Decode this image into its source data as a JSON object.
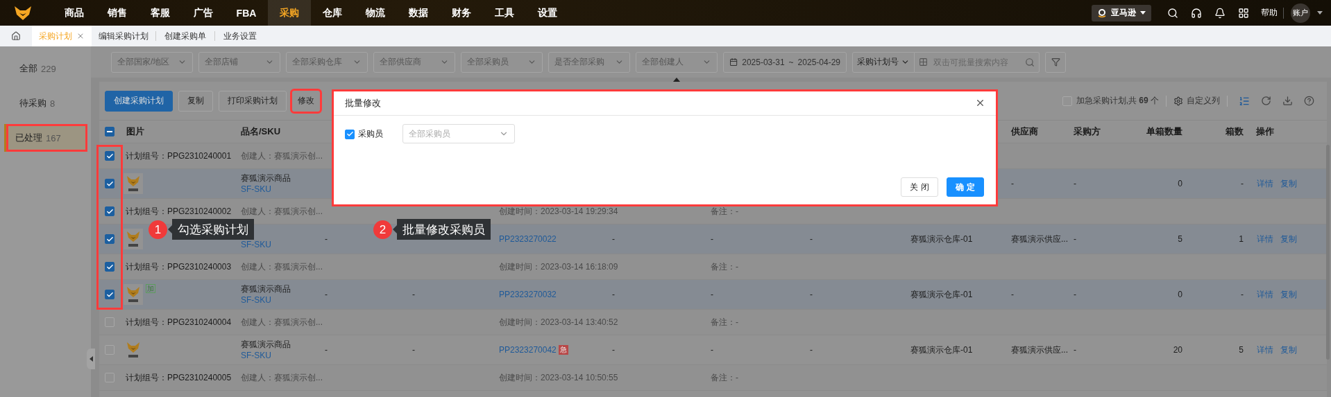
{
  "nav": {
    "menu": [
      {
        "label": "商品",
        "selected": false
      },
      {
        "label": "销售",
        "selected": false
      },
      {
        "label": "客服",
        "selected": false
      },
      {
        "label": "广告",
        "selected": false
      },
      {
        "label": "FBA",
        "selected": false
      },
      {
        "label": "采购",
        "selected": true
      },
      {
        "label": "仓库",
        "selected": false
      },
      {
        "label": "物流",
        "selected": false
      },
      {
        "label": "数据",
        "selected": false
      },
      {
        "label": "财务",
        "selected": false
      },
      {
        "label": "工具",
        "selected": false
      },
      {
        "label": "设置",
        "selected": false
      }
    ],
    "store": "亚马逊",
    "help": "帮助",
    "account": "账户"
  },
  "tabs": [
    {
      "label": "采购计划",
      "selected": true,
      "closable": true
    },
    {
      "label": "编辑采购计划",
      "selected": false,
      "closable": false
    },
    {
      "label": "创建采购单",
      "selected": false,
      "closable": false
    },
    {
      "label": "业务设置",
      "selected": false,
      "closable": false
    }
  ],
  "sidebar": [
    {
      "label": "全部",
      "count": "229",
      "selected": false,
      "highlighted": false
    },
    {
      "label": "待采购",
      "count": "8",
      "selected": false,
      "highlighted": false
    },
    {
      "label": "已处理",
      "count": "167",
      "selected": true,
      "highlighted": true
    }
  ],
  "filters": {
    "selects": [
      "全部国家/地区",
      "全部店铺",
      "全部采购仓库",
      "全部供应商",
      "全部采购员",
      "是否全部采购",
      "全部创建人"
    ],
    "date_start": "2025-03-31",
    "date_sep": "~",
    "date_end": "2025-04-29",
    "search_field": "采购计划号",
    "search_placeholder": "双击可批量搜索内容"
  },
  "toolbar": {
    "buttons": [
      {
        "label": "创建采购计划",
        "kind": "primary",
        "highlighted": false
      },
      {
        "label": "复制",
        "kind": "default",
        "highlighted": false
      },
      {
        "label": "打印采购计划",
        "kind": "default",
        "highlighted": false
      },
      {
        "label": "修改",
        "kind": "text",
        "highlighted": true
      }
    ],
    "urgent": {
      "label": "加急采购计划,共 **69** 个",
      "checked": false
    },
    "columns_label": "自定义列"
  },
  "table": {
    "header_partial": true,
    "checkbox_highlight": true,
    "headers": {
      "picture": "图片",
      "name_sku": "品名/SKU",
      "supplier": "供应商",
      "buyer": "采购方",
      "per_box_qty": "单箱数量",
      "boxes": "箱数",
      "actions": "操作"
    },
    "groups": [
      {
        "checked": true,
        "plan_group": "计划组号：PPG2310240001",
        "creator": "创建人：赛狐演示创...",
        "item": {
          "checked": true,
          "name": "赛狐演示商品",
          "sku": "SF-SKU",
          "supplier": "-",
          "buyer": "-",
          "per_box_qty": "0",
          "boxes": "-",
          "actions": [
            "详情",
            "复制"
          ]
        }
      },
      {
        "checked": true,
        "plan_group": "计划组号：PPG2310240002",
        "creator": "创建人：赛狐演示创...",
        "created_at": "创建时间：2023-03-14 19:29:34",
        "remark": "备注：-",
        "item": {
          "checked": true,
          "sku": "SF-SKU",
          "col_a": "-",
          "plan_no": "PP2323270022",
          "col_d": "-",
          "col_e": "-",
          "col_f": "-",
          "warehouse": "赛狐演示仓库-01",
          "supplier": "赛狐演示供应...",
          "buyer": "-",
          "per_box_qty": "5",
          "boxes": "1",
          "actions": [
            "详情",
            "复制"
          ]
        }
      },
      {
        "checked": true,
        "plan_group": "计划组号：PPG2310240003",
        "creator": "创建人：赛狐演示创...",
        "created_at": "创建时间：2023-03-14 16:18:09",
        "remark": "备注：-",
        "item": {
          "checked": true,
          "tag": "加",
          "name": "赛狐演示商品",
          "sku": "SF-SKU",
          "col_a": "-",
          "col_b": "-",
          "plan_no": "PP2323270032",
          "col_d": "-",
          "col_e": "-",
          "col_f": "-",
          "warehouse": "赛狐演示仓库-01",
          "supplier": "-",
          "buyer": "-",
          "per_box_qty": "0",
          "boxes": "-",
          "actions": [
            "详情",
            "复制"
          ]
        }
      },
      {
        "checked": false,
        "plan_group": "计划组号：PPG2310240004",
        "creator": "创建人：赛狐演示创...",
        "created_at": "创建时间：2023-03-14 13:40:52",
        "remark": "备注：-",
        "item": {
          "checked": false,
          "name": "赛狐演示商品",
          "sku": "SF-SKU",
          "col_a": "-",
          "col_b": "-",
          "plan_no": "PP2323270042",
          "urgent_tag": "急",
          "col_d": "-",
          "col_e": "-",
          "col_f": "-",
          "warehouse": "赛狐演示仓库-01",
          "supplier": "赛狐演示供应...",
          "buyer": "-",
          "per_box_qty": "20",
          "boxes": "5",
          "actions": [
            "详情",
            "复制"
          ]
        }
      },
      {
        "checked": false,
        "plan_group": "计划组号：PPG2310240005",
        "creator": "创建人：赛狐演示创...",
        "created_at": "创建时间：2023-03-14 10:50:55",
        "remark": "备注：-"
      }
    ]
  },
  "modal": {
    "title": "批量修改",
    "highlighted": true,
    "field": {
      "label": "采购员",
      "checked": true,
      "placeholder": "全部采购员"
    },
    "buttons": [
      {
        "label": "关 闭",
        "kind": "default"
      },
      {
        "label": "确 定",
        "kind": "primary"
      }
    ]
  },
  "annotations": [
    {
      "number": "1",
      "text": "勾选采购计划"
    },
    {
      "number": "2",
      "text": "批量修改采购员"
    }
  ]
}
